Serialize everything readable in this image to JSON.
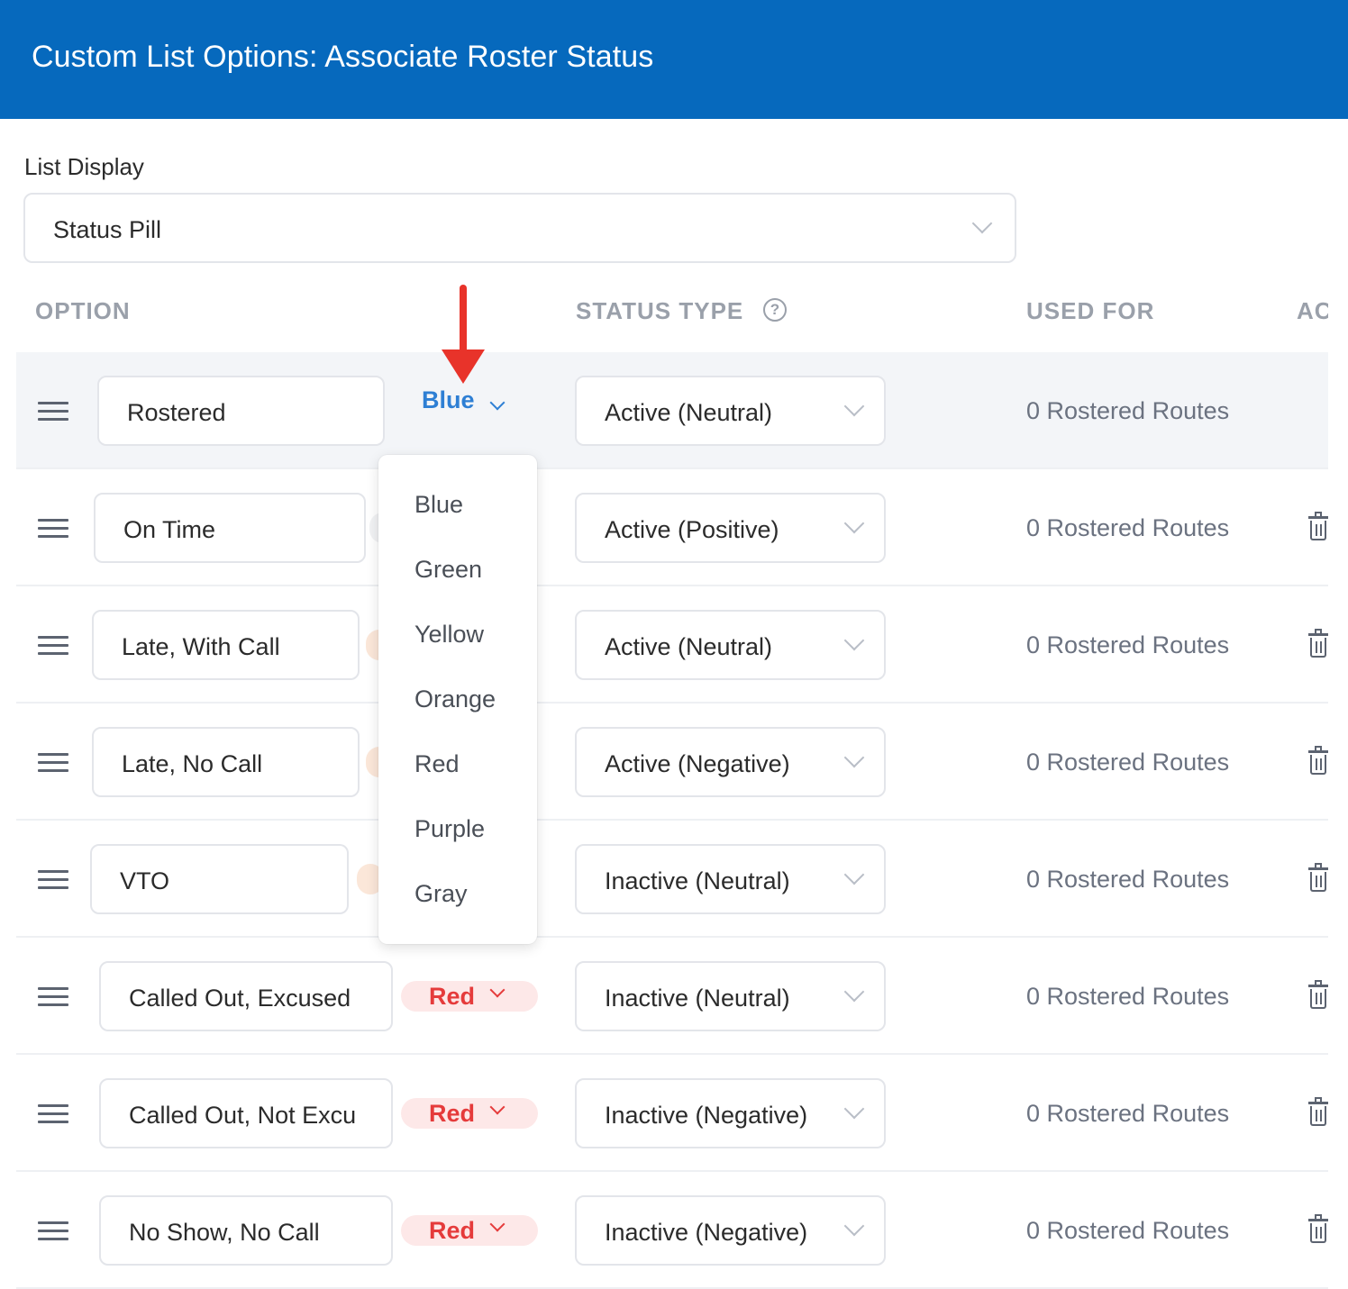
{
  "header": {
    "title": "Custom List Options: Associate Roster Status"
  },
  "list_display": {
    "label": "List Display",
    "value": "Status Pill"
  },
  "table": {
    "columns": {
      "option": "OPTION",
      "status_type": "STATUS TYPE",
      "used_for": "USED FOR",
      "actions": "AC"
    },
    "rows": [
      {
        "name": "Rostered",
        "color": "Blue",
        "status_type": "Active (Neutral)",
        "used_for": "0 Rostered Routes"
      },
      {
        "name": "On Time",
        "color": "",
        "status_type": "Active (Positive)",
        "used_for": "0 Rostered Routes"
      },
      {
        "name": "Late, With Call",
        "color": "",
        "status_type": "Active (Neutral)",
        "used_for": "0 Rostered Routes"
      },
      {
        "name": "Late, No Call",
        "color": "",
        "status_type": "Active (Negative)",
        "used_for": "0 Rostered Routes"
      },
      {
        "name": "VTO",
        "color": "",
        "status_type": "Inactive (Neutral)",
        "used_for": "0 Rostered Routes"
      },
      {
        "name": "Called Out, Excused",
        "color": "Red",
        "status_type": "Inactive (Neutral)",
        "used_for": "0 Rostered Routes"
      },
      {
        "name": "Called Out, Not Excu",
        "color": "Red",
        "status_type": "Inactive (Negative)",
        "used_for": "0 Rostered Routes"
      },
      {
        "name": "No Show, No Call",
        "color": "Red",
        "status_type": "Inactive (Negative)",
        "used_for": "0 Rostered Routes"
      }
    ]
  },
  "color_dropdown": {
    "options": [
      "Blue",
      "Green",
      "Yellow",
      "Orange",
      "Red",
      "Purple",
      "Gray"
    ]
  },
  "icons": {
    "row_handle": "drag-handle-icon",
    "row_action": "trash-icon",
    "select_caret": "chevron-down-icon",
    "help": "question-circle-icon",
    "annotation": "red-arrow-annotation"
  },
  "colors": {
    "header": "#0669bd",
    "pill_blue": "#2e7fd4",
    "pill_red": "#e53b3b",
    "pill_red_bg": "#fde8e8",
    "annotation": "#e8332a"
  }
}
